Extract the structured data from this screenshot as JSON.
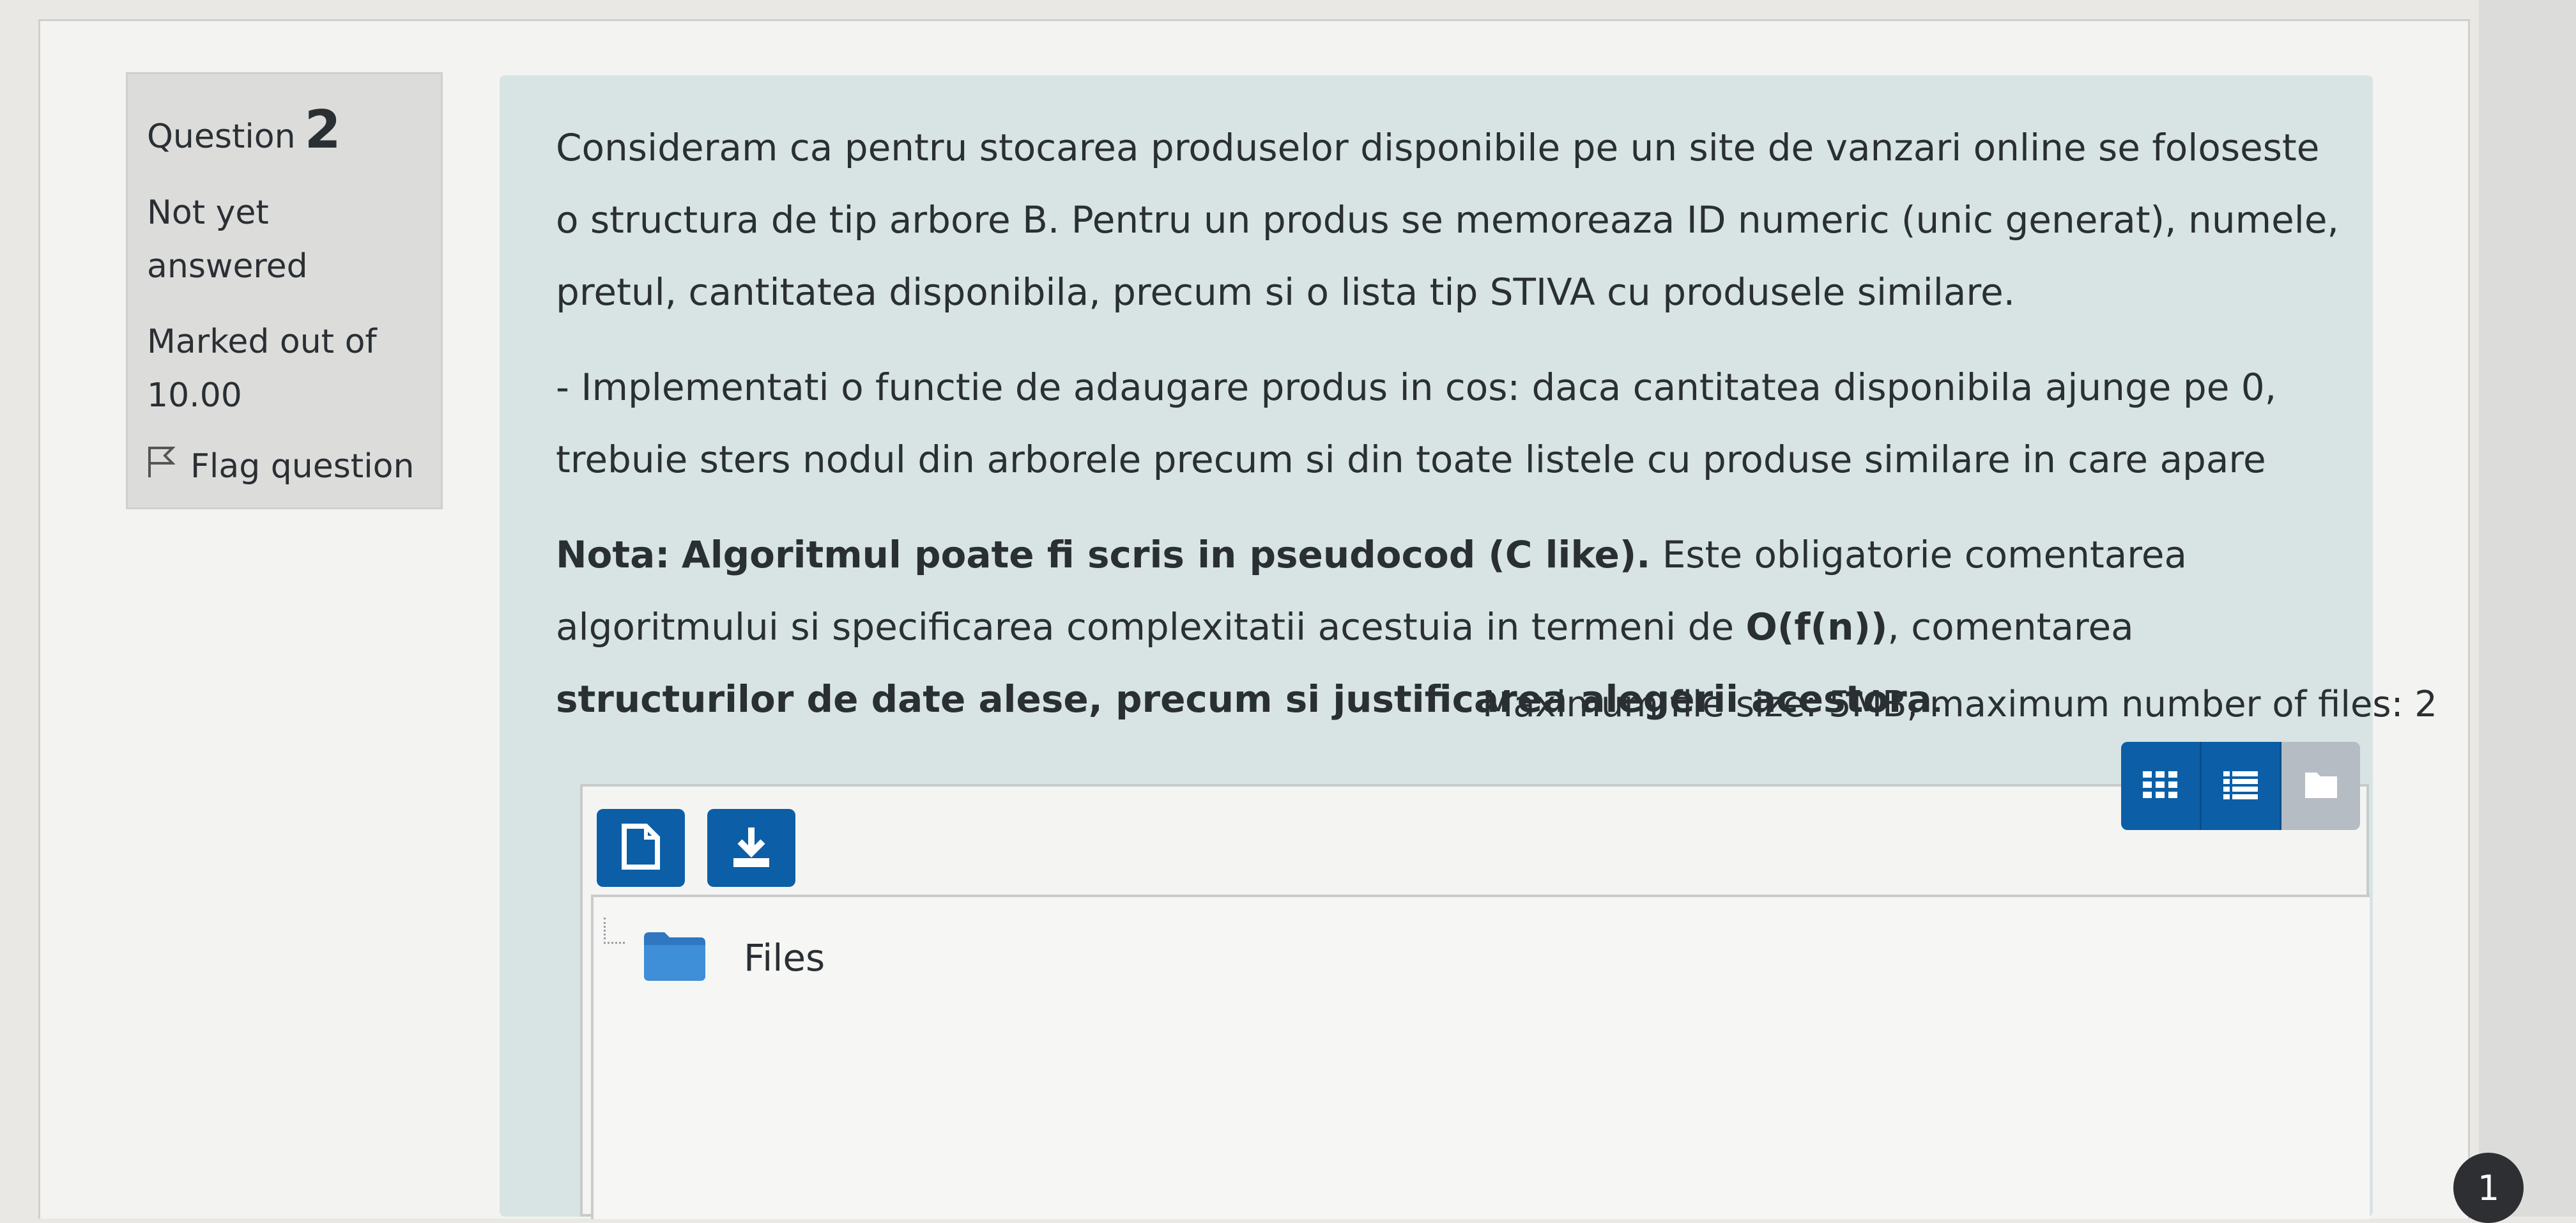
{
  "question": {
    "label": "Question",
    "number": "2",
    "status": "Not yet answered",
    "marks": "Marked out of 10.00",
    "flag_label": "Flag question"
  },
  "text": {
    "p1": "Consideram ca pentru stocarea produselor disponibile pe un site de vanzari online se foloseste o structura de tip arbore B. Pentru un produs se memoreaza ID numeric (unic generat), numele, pretul, cantitatea disponibila, precum si o lista tip STIVA cu produsele similare.",
    "p2": "- Implementati o functie de adaugare produs in cos: daca cantitatea disponibila ajunge pe 0, trebuie sters nodul din arborele precum si din toate listele cu produse similare in care apare",
    "p3_nota": "Nota:",
    "p3_bold1": "Algoritmul poate fi scris in pseudocod (C like).",
    "p3_text1": " Este obligatorie comentarea algoritmului si specificarea complexitatii acestuia in termeni de ",
    "p3_bold2": "O(f(n))",
    "p3_text2": ", comentarea ",
    "p3_bold3": "structurilor de date alese, precum si justificarea alegerii acestora",
    "p3_text3": "."
  },
  "filemanager": {
    "limits": "Maximum file size: 5MB, maximum number of files: 2",
    "folder_label": "Files",
    "add_file_icon": "file-icon",
    "download_icon": "download-icon",
    "views": [
      "grid-view-icon",
      "list-view-icon",
      "folder-view-icon"
    ]
  },
  "badge": "1",
  "colors": {
    "primary": "#0c5fa6",
    "panel": "#d7e4e3",
    "info": "#dcdcdb"
  }
}
